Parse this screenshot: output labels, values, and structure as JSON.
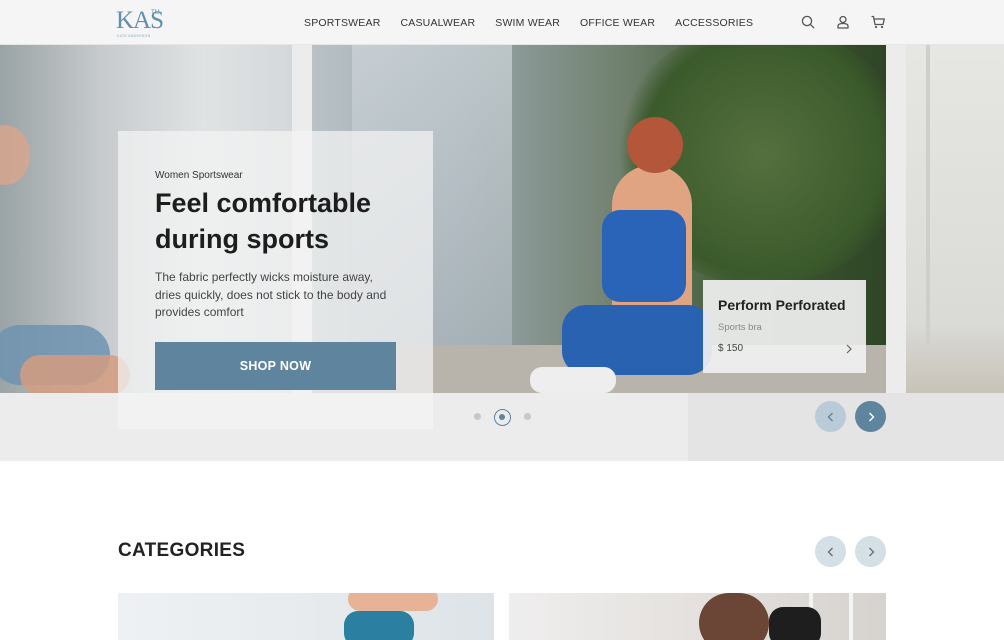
{
  "brand": {
    "logo_text": "KAS",
    "logo_tm": "TM",
    "logo_sub": "KATE ANDERSON"
  },
  "nav": {
    "items": [
      {
        "label": "SPORTSWEAR"
      },
      {
        "label": "CASUALWEAR"
      },
      {
        "label": "SWIM WEAR"
      },
      {
        "label": "OFFICE WEAR"
      },
      {
        "label": "ACCESSORIES"
      }
    ]
  },
  "header_icons": [
    "search-icon",
    "user-icon",
    "cart-icon"
  ],
  "hero": {
    "eyebrow": "Women Sportswear",
    "title": "Feel comfortable during sports",
    "description": "The fabric perfectly wicks moisture away, dries quickly, does not stick to the body and provides comfort",
    "cta_label": "SHOP NOW",
    "slides_total": 3,
    "active_slide": 2
  },
  "product": {
    "name": "Perform Perforated",
    "type": "Sports bra",
    "price": "$ 150"
  },
  "categories": {
    "title": "CATEGORIES"
  },
  "colors": {
    "accent": "#5f849e",
    "accent_light": "#b9cbd6",
    "logo": "#5f8fae",
    "header_bg": "#f5f5f5"
  }
}
